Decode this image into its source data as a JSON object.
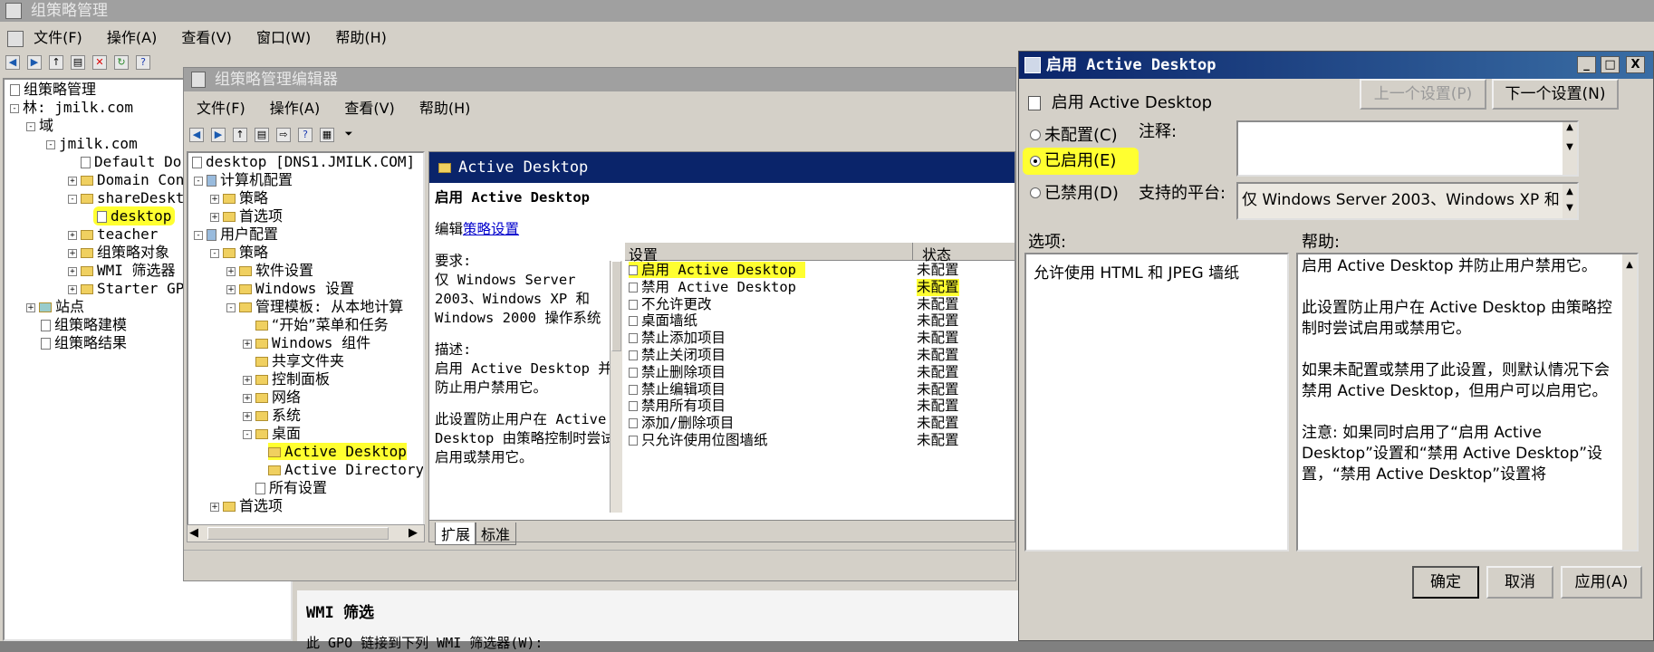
{
  "gpm": {
    "title": "组策略管理",
    "menu": [
      "文件(F)",
      "操作(A)",
      "查看(V)",
      "窗口(W)",
      "帮助(H)"
    ],
    "tree": {
      "root": "组策略管理",
      "forest": "林: jmilk.com",
      "domains": "域",
      "domain": "jmilk.com",
      "items": [
        "Default Dor",
        "Domain Cont",
        "shareDeskto",
        "desktop",
        "teacher",
        "组策略对象",
        "WMI 筛选器",
        "Starter GPO"
      ],
      "sites": "站点",
      "modeling": "组策略建模",
      "results": "组策略结果"
    },
    "wmi_heading": "WMI 筛选",
    "wmi_text": "此 GPO 链接到下列 WMI 筛选器(W):"
  },
  "gpe": {
    "title": "组策略管理编辑器",
    "menu": [
      "文件(F)",
      "操作(A)",
      "查看(V)",
      "帮助(H)"
    ],
    "tree": {
      "root": "desktop [DNS1.JMILK.COM] 策",
      "computer_config": "计算机配置",
      "policies": "策略",
      "preferences": "首选项",
      "user_config": "用户配置",
      "policies2": "策略",
      "software": "软件设置",
      "windows": "Windows 设置",
      "admin_templates": "管理模板: 从本地计算",
      "start_menu": "“开始”菜单和任务",
      "win_components": "Windows 组件",
      "shared_folders": "共享文件夹",
      "control_panel": "控制面板",
      "network": "网络",
      "system": "系统",
      "desktop": "桌面",
      "active_desktop": "Active Desktop",
      "active_directory": "Active Directory",
      "all_settings": "所有设置",
      "preferences2": "首选项"
    },
    "pane_title": "Active Desktop",
    "desc": {
      "heading": "启用 Active Desktop",
      "edit_prefix": "编辑",
      "edit_link": "策略设置",
      "req_label": "要求:",
      "req_text": "仅 Windows Server 2003、Windows XP 和 Windows 2000 操作系统",
      "desc_label": "描述:",
      "desc_text": "启用 Active Desktop 并防止用户禁用它。",
      "desc_text2": "此设置防止用户在 Active Desktop 由策略控制时尝试启用或禁用它。"
    },
    "columns": {
      "setting": "设置",
      "state": "状态"
    },
    "rows": [
      {
        "name": "启用 Active Desktop",
        "state": "未配置"
      },
      {
        "name": "禁用 Active Desktop",
        "state": "未配置"
      },
      {
        "name": "不允许更改",
        "state": "未配置"
      },
      {
        "name": "桌面墙纸",
        "state": "未配置"
      },
      {
        "name": "禁止添加项目",
        "state": "未配置"
      },
      {
        "name": "禁止关闭项目",
        "state": "未配置"
      },
      {
        "name": "禁止删除项目",
        "state": "未配置"
      },
      {
        "name": "禁止编辑项目",
        "state": "未配置"
      },
      {
        "name": "禁用所有项目",
        "state": "未配置"
      },
      {
        "name": "添加/删除项目",
        "state": "未配置"
      },
      {
        "name": "只允许使用位图墙纸",
        "state": "未配置"
      }
    ],
    "tabs": [
      "扩展",
      "标准"
    ]
  },
  "dlg": {
    "title": "启用 Active Desktop",
    "header": "启用 Active Desktop",
    "prev_button": "上一个设置(P)",
    "next_button": "下一个设置(N)",
    "not_configured": "未配置(C)",
    "enabled": "已启用(E)",
    "disabled": "已禁用(D)",
    "comment_label": "注释:",
    "platform_label": "支持的平台:",
    "platform_value": "仅 Windows Server 2003、Windows XP 和",
    "options_label": "选项:",
    "help_label": "帮助:",
    "option_text": "允许使用 HTML 和 JPEG 墙纸",
    "help_p1": "启用 Active Desktop 并防止用户禁用它。",
    "help_p2": "此设置防止用户在 Active Desktop 由策略控制时尝试启用或禁用它。",
    "help_p3": "如果未配置或禁用了此设置，则默认情况下会禁用 Active Desktop，但用户可以启用它。",
    "help_p4": "注意: 如果同时启用了“启用 Active Desktop”设置和“禁用 Active Desktop”设置，“禁用 Active Desktop”设置将",
    "ok_button": "确定",
    "cancel_button": "取消",
    "apply_button": "应用(A)",
    "minimize": "_",
    "maximize": "□",
    "close": "X"
  }
}
